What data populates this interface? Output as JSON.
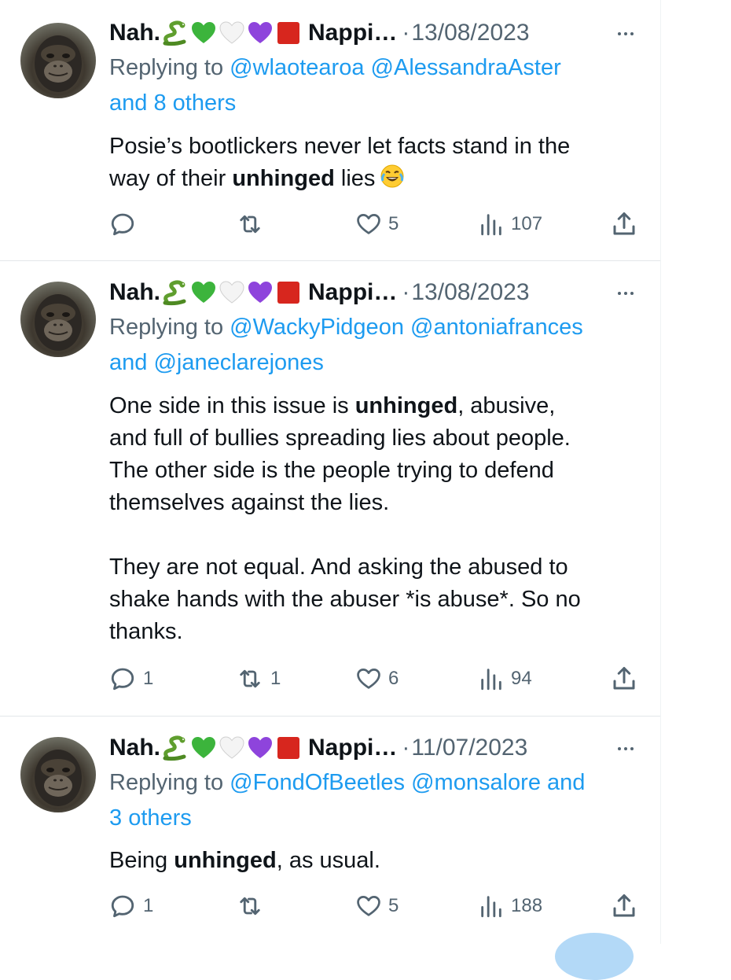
{
  "tweets": [
    {
      "display_name": "Nah.",
      "emojis": [
        "snake-emoji",
        "green-heart-emoji",
        "white-heart-emoji",
        "purple-heart-emoji",
        "red-square-emoji"
      ],
      "handle": "Nappi…",
      "separator": "·",
      "date": "13/08/2023",
      "replying_label": "Replying to",
      "reply_line1_mentions": [
        "@wlaotearoa",
        "@AlessandraAster"
      ],
      "reply_line2": "and 8 others",
      "body": [
        {
          "t": "Posie’s bootlickers never let facts stand in the"
        },
        {
          "t": "way of their "
        },
        {
          "b": "unhinged"
        },
        {
          "t": " lies"
        }
      ],
      "body_emoji": "face-with-tears-of-joy-emoji",
      "stats": {
        "replies": "",
        "retweets": "",
        "likes": "5",
        "views": "107"
      }
    },
    {
      "display_name": "Nah.",
      "emojis": [
        "snake-emoji",
        "green-heart-emoji",
        "white-heart-emoji",
        "purple-heart-emoji",
        "red-square-emoji"
      ],
      "handle": "Nappi…",
      "separator": "·",
      "date": "13/08/2023",
      "replying_label": "Replying to",
      "reply_line1_mentions": [
        "@WackyPidgeon",
        "@antoniafrances"
      ],
      "reply_line2_prefix": "and",
      "reply_line2_mention": "@janeclarejones",
      "body_para1_a": "One side in this issue is ",
      "body_para1_b": "unhinged",
      "body_para1_c": ", abusive,",
      "body_lines": [
        "and full of bullies spreading lies about people.",
        "The other side is the people trying to defend",
        "themselves against the lies.",
        "",
        "They are not equal. And asking the abused to",
        "shake hands with the abuser *is abuse*. So no",
        "thanks."
      ],
      "stats": {
        "replies": "1",
        "retweets": "1",
        "likes": "6",
        "views": "94"
      }
    },
    {
      "display_name": "Nah.",
      "emojis": [
        "snake-emoji",
        "green-heart-emoji",
        "white-heart-emoji",
        "purple-heart-emoji",
        "red-square-emoji"
      ],
      "handle": "Nappi…",
      "separator": "·",
      "date": "11/07/2023",
      "replying_label": "Replying to",
      "reply_line1_mentions": [
        "@FondOfBeetles",
        "@monsalore"
      ],
      "reply_line1_suffix": "and",
      "reply_line2_a": "3",
      "reply_line2_b": "others",
      "body_a": "Being ",
      "body_b": "unhinged",
      "body_c": ", as usual.",
      "stats": {
        "replies": "1",
        "retweets": "",
        "likes": "5",
        "views": "188"
      }
    }
  ],
  "colors": {
    "text": "#0f1419",
    "secondary": "#536471",
    "link": "#1d9bf0",
    "divider": "#e3e7ea"
  }
}
